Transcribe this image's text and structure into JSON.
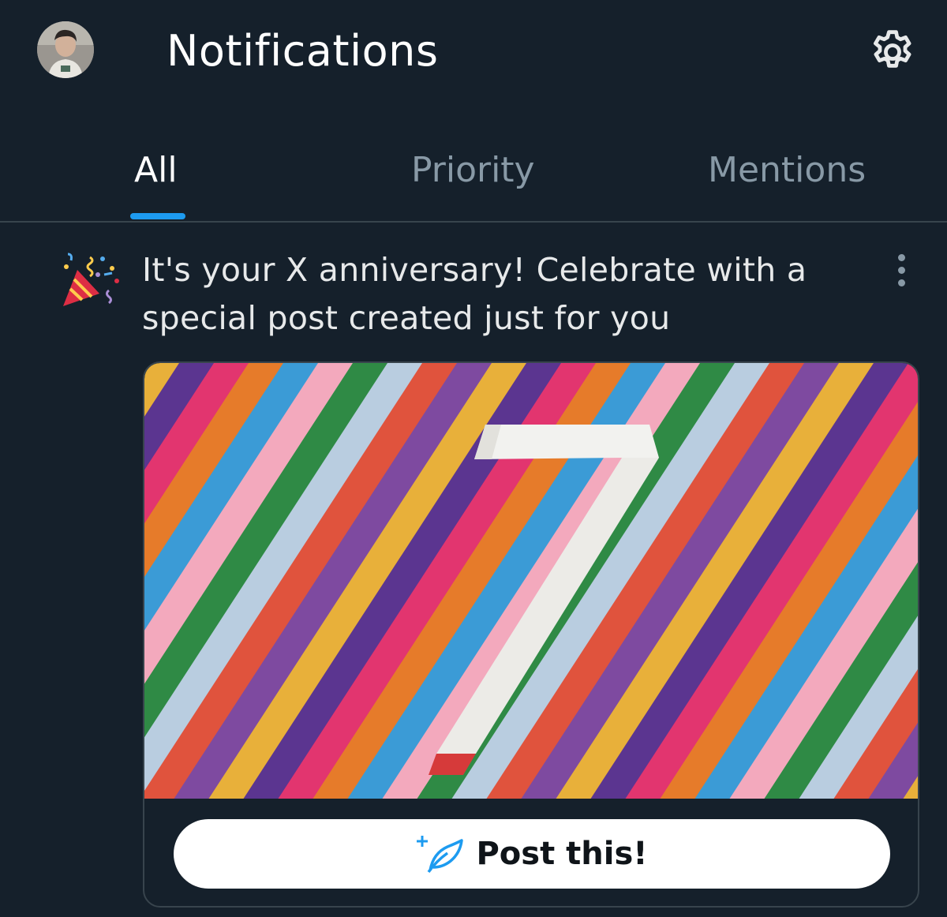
{
  "header": {
    "title": "Notifications",
    "avatar_icon": "user-avatar",
    "settings_icon": "gear-icon"
  },
  "tabs": [
    {
      "label": "All",
      "active": true
    },
    {
      "label": "Priority",
      "active": false
    },
    {
      "label": "Mentions",
      "active": false
    }
  ],
  "notification": {
    "icon": "party-popper-icon",
    "text": "It's your X anniversary! Celebrate with a special post created just for you",
    "more_icon": "more-vertical-icon",
    "image_number": "7",
    "button_icon": "compose-sparkle-icon",
    "button_label": "Post this!"
  },
  "colors": {
    "background": "#15202b",
    "accent": "#1d9bf0",
    "tab_inactive": "#8899a6",
    "divider": "#38444d"
  }
}
